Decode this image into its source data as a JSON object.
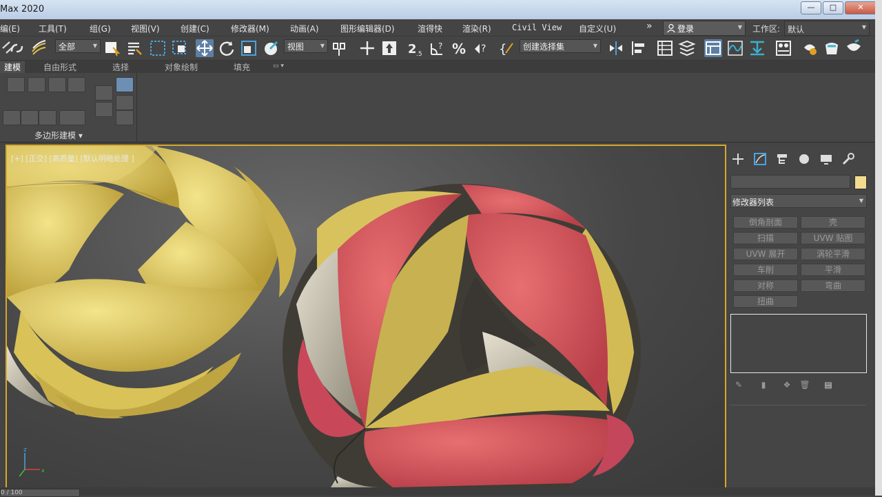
{
  "window": {
    "title": "Max 2020",
    "minimize": "—",
    "restore": "□",
    "close": "✕"
  },
  "menu": [
    "编(E)",
    "工具(T)",
    "组(G)",
    "视图(V)",
    "创建(C)",
    "修改器(M)",
    "动画(A)",
    "图形编辑器(D)",
    "渲得快",
    "渲染(R)",
    "Civil View",
    "自定义(U)"
  ],
  "menu_more": "»",
  "login": "登录",
  "workspace": {
    "label": "工作区:",
    "value": "默认"
  },
  "toolbar": {
    "filter": "全部",
    "refcoord": "视图",
    "selection_set": "创建选择集"
  },
  "ribbon_tabs": [
    "建模",
    "自由形式",
    "选择",
    "对象绘制",
    "填充"
  ],
  "ribbon_panel_label": "多边形建模 ▾",
  "viewport": {
    "label": "[+] [正交] [高质量] [默认明暗处理 ]"
  },
  "command_panel": {
    "modifier_list": "修改器列表",
    "modifiers": [
      "倒角剖面",
      "壳",
      "扫描",
      "UVW 贴图",
      "UVW 展开",
      "涡轮平滑",
      "车削",
      "平滑",
      "对称",
      "弯曲",
      "扭曲"
    ]
  },
  "timeslider": "0 / 100",
  "colors": {
    "accent": "#4aa3df",
    "viewport_border": "#d7a82a",
    "red_sphere": "#d95a5c",
    "yellow_sphere": "#e2cc62",
    "object_color": "#f2dc90"
  }
}
